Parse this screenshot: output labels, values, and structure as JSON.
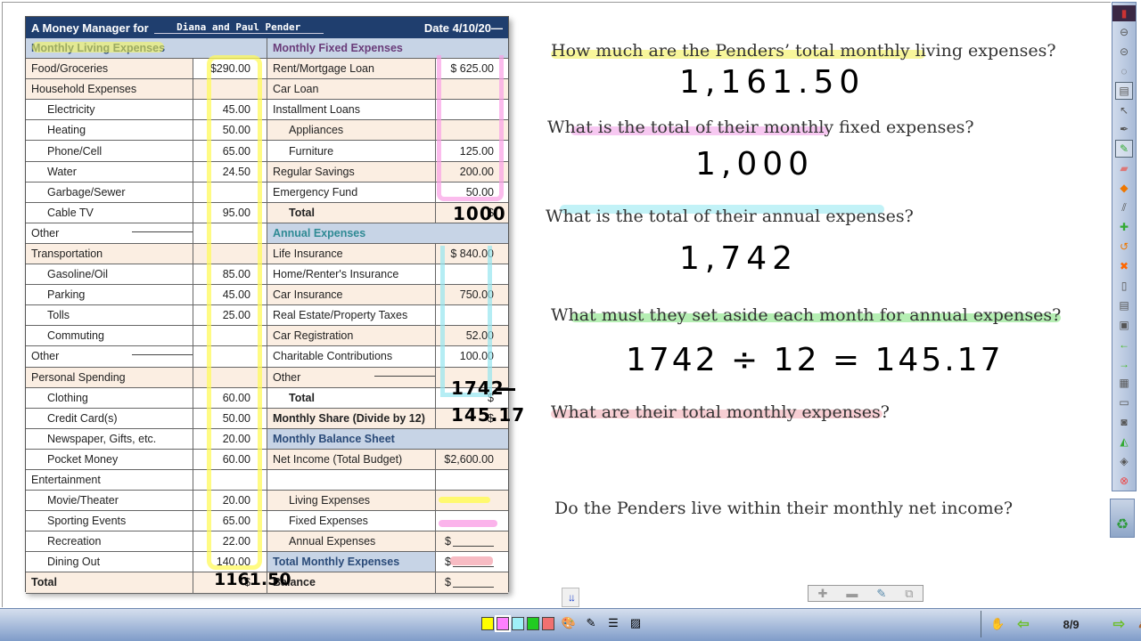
{
  "worksheet": {
    "title_prefix": "A Money Manager for",
    "names": "Diana and Paul Pender",
    "date": "Date 4/10/20—",
    "left_header": "Monthly Living Expenses",
    "left_rows": [
      {
        "label": "Food/Groceries",
        "value": "$290.00",
        "style": "tan",
        "indent": false
      },
      {
        "label": "Household Expenses",
        "value": "",
        "style": "tan-full",
        "indent": false
      },
      {
        "label": "Electricity",
        "value": "45.00",
        "style": "wh",
        "indent": true
      },
      {
        "label": "Heating",
        "value": "50.00",
        "style": "tan",
        "indent": true
      },
      {
        "label": "Phone/Cell",
        "value": "65.00",
        "style": "wh",
        "indent": true
      },
      {
        "label": "Water",
        "value": "24.50",
        "style": "tan",
        "indent": true
      },
      {
        "label": "Garbage/Sewer",
        "value": "",
        "style": "wh",
        "indent": true
      },
      {
        "label": "Cable TV",
        "value": "95.00",
        "style": "tan",
        "indent": true
      },
      {
        "label": "Other",
        "value": "",
        "style": "wh",
        "indent": false,
        "blank": true
      },
      {
        "label": "Transportation",
        "value": "",
        "style": "tan-full",
        "indent": false
      },
      {
        "label": "Gasoline/Oil",
        "value": "85.00",
        "style": "wh",
        "indent": true
      },
      {
        "label": "Parking",
        "value": "45.00",
        "style": "tan",
        "indent": true
      },
      {
        "label": "Tolls",
        "value": "25.00",
        "style": "wh",
        "indent": true
      },
      {
        "label": "Commuting",
        "value": "",
        "style": "tan",
        "indent": true
      },
      {
        "label": "Other",
        "value": "",
        "style": "wh",
        "indent": false,
        "blank": true
      },
      {
        "label": "Personal Spending",
        "value": "",
        "style": "tan-full",
        "indent": false
      },
      {
        "label": "Clothing",
        "value": "60.00",
        "style": "wh",
        "indent": true
      },
      {
        "label": "Credit Card(s)",
        "value": "50.00",
        "style": "tan",
        "indent": true
      },
      {
        "label": "Newspaper, Gifts, etc.",
        "value": "20.00",
        "style": "wh",
        "indent": true
      },
      {
        "label": "Pocket Money",
        "value": "60.00",
        "style": "tan",
        "indent": true
      },
      {
        "label": "Entertainment",
        "value": "",
        "style": "wh-full",
        "indent": false
      },
      {
        "label": "Movie/Theater",
        "value": "20.00",
        "style": "tan",
        "indent": true
      },
      {
        "label": "Sporting Events",
        "value": "65.00",
        "style": "wh",
        "indent": true
      },
      {
        "label": "Recreation",
        "value": "22.00",
        "style": "tan",
        "indent": true
      },
      {
        "label": "Dining Out",
        "value": "140.00",
        "style": "wh",
        "indent": true
      },
      {
        "label": "Total",
        "value": "$",
        "style": "tan-full",
        "indent": false,
        "bold": true
      }
    ],
    "right_header_fixed": "Monthly Fixed Expenses",
    "right_fixed_rows": [
      {
        "label": "Rent/Mortgage Loan",
        "value": "$   625.00",
        "style": "tan",
        "indent": false
      },
      {
        "label": "Car Loan",
        "value": "",
        "style": "tan-full",
        "indent": false
      },
      {
        "label": "Installment Loans",
        "value": "",
        "style": "wh",
        "indent": false
      },
      {
        "label": "Appliances",
        "value": "",
        "style": "tan-full",
        "indent": true
      },
      {
        "label": "Furniture",
        "value": "125.00",
        "style": "wh",
        "indent": true
      },
      {
        "label": "Regular Savings",
        "value": "200.00",
        "style": "tan-full",
        "indent": false
      },
      {
        "label": "Emergency Fund",
        "value": "50.00",
        "style": "wh",
        "indent": false
      },
      {
        "label": "Total",
        "value": "$",
        "style": "tan-full",
        "indent": true,
        "bold": true
      }
    ],
    "right_header_annual": "Annual Expenses",
    "right_annual_rows": [
      {
        "label": "Life Insurance",
        "value": "$   840.00",
        "style": "tan-full",
        "indent": false
      },
      {
        "label": "Home/Renter's Insurance",
        "value": "",
        "style": "wh",
        "indent": false
      },
      {
        "label": "Car Insurance",
        "value": "750.00",
        "style": "tan-full",
        "indent": false
      },
      {
        "label": "Real Estate/Property Taxes",
        "value": "",
        "style": "wh",
        "indent": false
      },
      {
        "label": "Car Registration",
        "value": "52.00",
        "style": "tan-full",
        "indent": false
      },
      {
        "label": "Charitable Contributions",
        "value": "100.00",
        "style": "wh",
        "indent": false
      },
      {
        "label": "Other",
        "value": "",
        "style": "tan-full",
        "indent": false,
        "blank": true
      },
      {
        "label": "Total",
        "value": "$",
        "style": "wh",
        "indent": true,
        "bold": true
      },
      {
        "label": "Monthly Share (Divide by 12)",
        "value": "$",
        "style": "tan-full",
        "indent": false,
        "bold": true
      }
    ],
    "right_header_balance": "Monthly Balance Sheet",
    "right_balance_rows": [
      {
        "label": "Net Income (Total Budget)",
        "value": "$2,600.00",
        "style": "tan-full",
        "indent": false
      },
      {
        "label": "",
        "value": "",
        "style": "wh",
        "indent": false
      },
      {
        "label": "Living Expenses",
        "value": "",
        "style": "tan-full",
        "indent": true
      },
      {
        "label": "Fixed Expenses",
        "value": "",
        "style": "wh",
        "indent": true
      },
      {
        "label": "Annual Expenses",
        "value": "$",
        "style": "tan-full",
        "indent": true,
        "blankval": true
      },
      {
        "label": "Total Monthly Expenses",
        "value": "$",
        "style": "balhdr",
        "indent": false,
        "bold": true,
        "blankval": true
      },
      {
        "label": "Balance",
        "value": "$",
        "style": "tan-full",
        "indent": false,
        "bold": true,
        "blankval": true
      }
    ],
    "handwritten": {
      "living_total": "1161.50",
      "fixed_total": "1000",
      "annual_total": "1742",
      "monthly_share": "145.17"
    }
  },
  "questions": [
    {
      "text": "How much are the Penders’ total monthly living expenses?",
      "answer": "1,161.50",
      "highlight": "#f6f37a"
    },
    {
      "text": "What is the total of their monthly fixed expenses?",
      "answer": "1,000",
      "highlight": "#f4b6ec"
    },
    {
      "text": "What is the total of their annual expenses?",
      "answer": "1,742",
      "highlight": "#aeeef4"
    },
    {
      "text": "What must they set aside each month for annual expenses?",
      "answer": "1742 ÷ 12 = 145.17",
      "highlight": "#9ce89a"
    },
    {
      "text": "What are their total monthly expenses?",
      "answer": "",
      "highlight": "#f5c2c8"
    },
    {
      "text": "Do the Penders live within their monthly net income?",
      "answer": "",
      "highlight": ""
    }
  ],
  "toolbar_right": {
    "items": [
      "app-menu",
      "minimize",
      "restore",
      "mouse",
      "page-sorter",
      "select-arrow",
      "pen",
      "highlighter",
      "eraser",
      "shapes",
      "line",
      "text-add",
      "undo",
      "delete",
      "blank-page",
      "page-template",
      "screen-shade",
      "previous-page",
      "next-page",
      "table",
      "save",
      "capture",
      "measure",
      "spotlight",
      "close"
    ]
  },
  "bottom_toolbar": {
    "swatches": [
      "#ffff00",
      "#ff80ff",
      "#9ff0f8",
      "#22cc22",
      "#f07070"
    ],
    "selected_swatch": 1,
    "page_indicator": "8/9"
  }
}
